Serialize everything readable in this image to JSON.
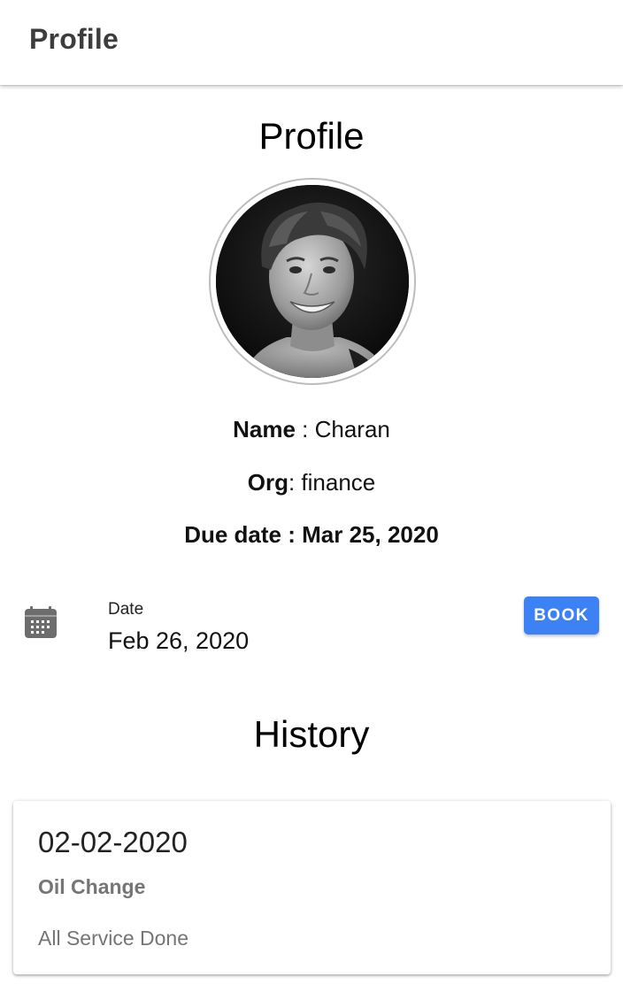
{
  "appbar": {
    "title": "Profile"
  },
  "profile": {
    "heading": "Profile",
    "avatar_icon": "user-photo",
    "name_label": "Name",
    "name_sep": " : ",
    "name_value": "Charan",
    "org_label": "Org",
    "org_sep": ": ",
    "org_value": "finance",
    "due_label": "Due date : ",
    "due_value": "Mar 25, 2020"
  },
  "booking": {
    "icon": "calendar-icon",
    "date_caption": "Date",
    "date_value": "Feb 26, 2020",
    "book_label": "BOOK",
    "accent_color": "#3d82f4"
  },
  "history": {
    "heading": "History",
    "items": [
      {
        "date": "02-02-2020",
        "service": "Oil Change",
        "status": "All Service Done"
      }
    ]
  }
}
